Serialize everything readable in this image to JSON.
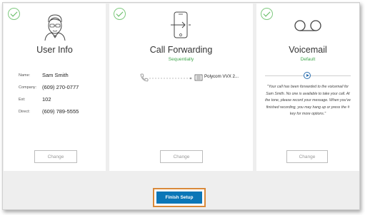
{
  "cards": {
    "user_info": {
      "title": "User Info",
      "fields": [
        {
          "label": "Name:",
          "value": "Sam Smith"
        },
        {
          "label": "Company:",
          "value": "(609) 270-0777"
        },
        {
          "label": "Ext:",
          "value": "102"
        },
        {
          "label": "Direct:",
          "value": "(609) 789-5555"
        }
      ],
      "button": "Change"
    },
    "call_forwarding": {
      "title": "Call Forwarding",
      "subtitle": "Sequentially",
      "device": "Polycom VVX 2...",
      "button": "Change"
    },
    "voicemail": {
      "title": "Voicemail",
      "subtitle": "Default",
      "message": "\"Your call has been forwarded to the voicemail for Sam Smith. No one is available to take your call. At the tone, please record your message. When you've finished recording, you may hang up or press the # key for more options.\"",
      "button": "Change"
    }
  },
  "footer": {
    "finish_label": "Finish Setup"
  },
  "colors": {
    "accent": "#0b76b7",
    "success": "#5cb85c",
    "highlight": "#d9893a"
  },
  "icons": [
    "check-icon",
    "user-avatar-icon",
    "phone-forward-icon",
    "handset-icon",
    "desk-phone-icon",
    "voicemail-icon",
    "play-icon"
  ]
}
